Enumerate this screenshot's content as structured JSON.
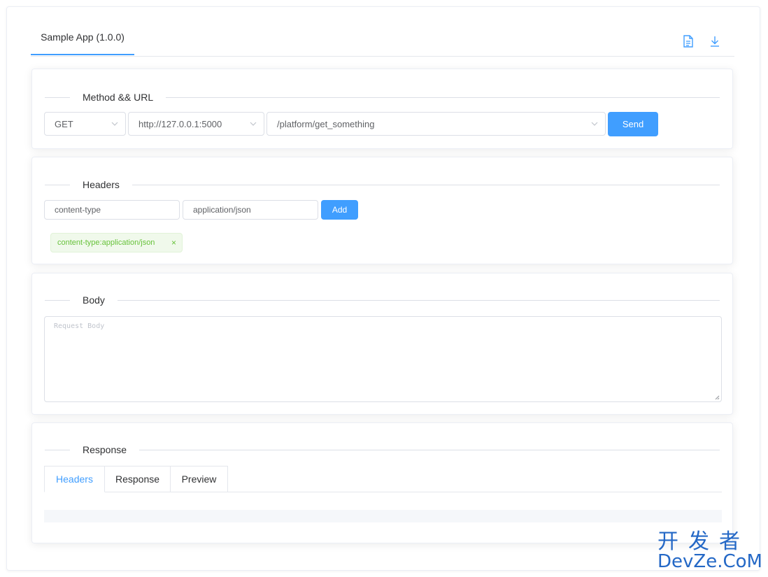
{
  "app": {
    "tab_label": "Sample App (1.0.0)",
    "toolbar_icons": [
      "document-icon",
      "download-icon"
    ]
  },
  "method_section": {
    "title": "Method && URL",
    "method": "GET",
    "host": "http://127.0.0.1:5000",
    "path": "/platform/get_something",
    "send_label": "Send"
  },
  "headers_section": {
    "title": "Headers",
    "key_value": "content-type",
    "value_value": "application/json",
    "add_label": "Add",
    "tags": [
      {
        "label": "content-type:application/json",
        "close": "×"
      }
    ]
  },
  "body_section": {
    "title": "Body",
    "placeholder": "Request Body"
  },
  "response_section": {
    "title": "Response",
    "tabs": [
      {
        "label": "Headers",
        "active": true
      },
      {
        "label": "Response",
        "active": false
      },
      {
        "label": "Preview",
        "active": false
      }
    ]
  },
  "watermark": {
    "line1": "开发者",
    "line2": "DevZe.CoM"
  },
  "colors": {
    "primary": "#409eff",
    "tag_text": "#67c23a",
    "tag_bg": "#f0f9eb",
    "watermark": "#2468c6"
  }
}
